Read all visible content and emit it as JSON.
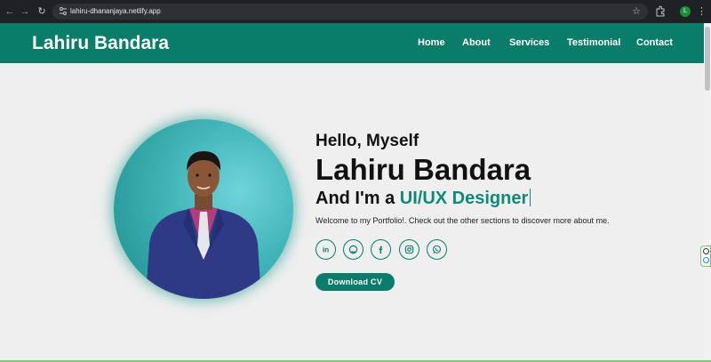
{
  "browser": {
    "url": "lahiru-dhananjaya.netlify.app",
    "profile_initial": "L",
    "icons": [
      "back-icon",
      "forward-icon",
      "reload-icon",
      "site-info-icon",
      "star-icon",
      "extensions-icon",
      "menu-icon"
    ]
  },
  "header": {
    "brand": "Lahiru Bandara",
    "nav": [
      "Home",
      "About",
      "Services",
      "Testimonial",
      "Contact"
    ]
  },
  "hero": {
    "greeting": "Hello, Myself",
    "name": "Lahiru Bandara",
    "role_prefix": "And I'm a ",
    "role": "UI/UX Designer",
    "welcome": "Welcome to my Portfolio!. Check out the other sections to discover more about me.",
    "social": [
      "linkedin-icon",
      "github-icon",
      "facebook-icon",
      "instagram-icon",
      "whatsapp-icon"
    ],
    "cta": "Download CV"
  },
  "colors": {
    "accent": "#0a7c6a",
    "accent_text": "#0f8a78",
    "page_bg": "#efefef"
  }
}
